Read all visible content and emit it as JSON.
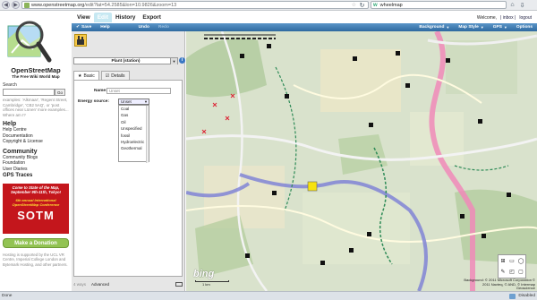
{
  "browser": {
    "url_host": "www.openstreetmap.org",
    "url_rest": "/edit?lat=54.2585&lon=10.9826&zoom=13",
    "search_engine": "wheelmap"
  },
  "osm": {
    "brand": "OpenStreetMap",
    "tagline": "The Free Wiki World Map",
    "search_label": "Search",
    "go_label": "Go",
    "search_examples": "examples: 'Alkmaar', 'Regent Street, Cambridge', 'CB2 5AQ', or 'post offices near Lünen' more examples... Where am I?",
    "help_heading": "Help",
    "help_links": [
      "Help Centre",
      "Documentation",
      "Copyright & License"
    ],
    "community_heading": "Community",
    "community_links": [
      "Community Blogs",
      "Foundation",
      "User Diaries"
    ],
    "gps_traces": "GPS Traces",
    "sotm_line1": "Come to State of the Map, September 9th-11th, Tokyo!",
    "sotm_line2": "6th annual International OpenStreetMap Conference",
    "sotm_big": "SOTM",
    "donate": "Make a Donation",
    "hosting": "Hosting is supported by the UCL VR Centre, Imperial College London and Bytemark Hosting, and other partners.",
    "tabs": [
      "View",
      "Edit",
      "History",
      "Export"
    ],
    "active_tab": "Edit",
    "welcome": "Welcome,",
    "inbox": "| inbox |",
    "logout": "logout"
  },
  "potlatch": {
    "save": "Save",
    "help": "Help",
    "undo": "Undo",
    "redo": "Redo",
    "background": "Background",
    "map_style": "Map Style",
    "gps": "GPS",
    "options": "Options"
  },
  "editor": {
    "preset": "Plant (station)",
    "tab_basic": "Basic",
    "tab_details": "Details",
    "name_label": "Name:",
    "name_value": "Unset",
    "energy_label": "Energy source:",
    "energy_value": "Unset",
    "energy_options": [
      "Coal",
      "Gas",
      "Oil",
      "Unspecified fossil",
      "Hydroelectric",
      "Geothermal"
    ],
    "foot_left": "4 ways",
    "advanced": "Advanced"
  },
  "map": {
    "scale": "1 km",
    "bing": "bing",
    "attribution": "Background: © 2011 Microsoft Corporation © 2011 Navteq, © AND, © Intermap Geoscience",
    "tools": [
      "⊞",
      "▭",
      "◯",
      "✎",
      "◰",
      "▢"
    ]
  },
  "status": {
    "left": "Done",
    "right": "Disabled"
  }
}
